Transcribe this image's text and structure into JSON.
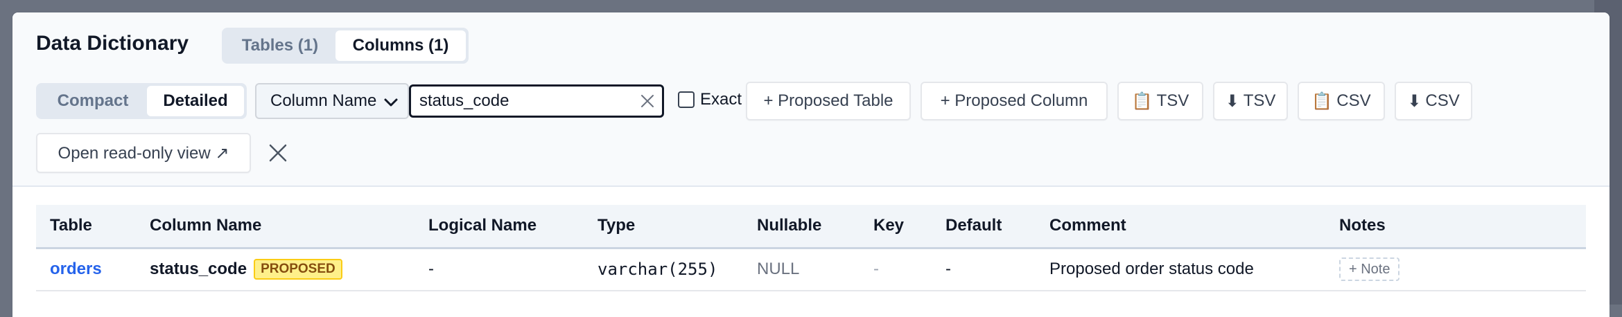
{
  "dialog": {
    "title": "Data Dictionary",
    "tabs": [
      {
        "label": "Tables (1)",
        "active": false
      },
      {
        "label": "Columns (1)",
        "active": true
      }
    ]
  },
  "toolbar": {
    "view_modes": [
      {
        "label": "Compact",
        "active": false
      },
      {
        "label": "Detailed",
        "active": true
      }
    ],
    "search_field": {
      "selected": "Column Name"
    },
    "search": {
      "value": "status_code",
      "placeholder": ""
    },
    "exact": {
      "label": "Exact",
      "checked": false
    },
    "proposed_table_label": "+ Proposed Table",
    "proposed_column_label": "+ Proposed Column",
    "copy_tsv_label": "TSV",
    "download_tsv_label": "TSV",
    "copy_csv_label": "CSV",
    "download_csv_label": "CSV",
    "open_readonly_label": "Open read-only view ↗"
  },
  "icons": {
    "clipboard": "📋",
    "download": "⬇",
    "chevron": "chevron-down-icon",
    "clear": "close-icon",
    "close": "close-icon"
  },
  "table": {
    "headers": {
      "table": "Table",
      "column_name": "Column Name",
      "logical_name": "Logical Name",
      "type": "Type",
      "nullable": "Nullable",
      "key": "Key",
      "default": "Default",
      "comment": "Comment",
      "notes": "Notes"
    },
    "rows": [
      {
        "table": "orders",
        "column_name": "status_code",
        "badge": "PROPOSED",
        "logical_name": "-",
        "type": "varchar(255)",
        "nullable": "NULL",
        "key": "-",
        "default": "-",
        "comment": "Proposed order status code",
        "notes_button": "+ Note"
      }
    ]
  },
  "colors": {
    "link": "#2563eb",
    "badge_bg": "#fef08a",
    "badge_text": "#854d0e",
    "backdrop": "#6b7280"
  }
}
